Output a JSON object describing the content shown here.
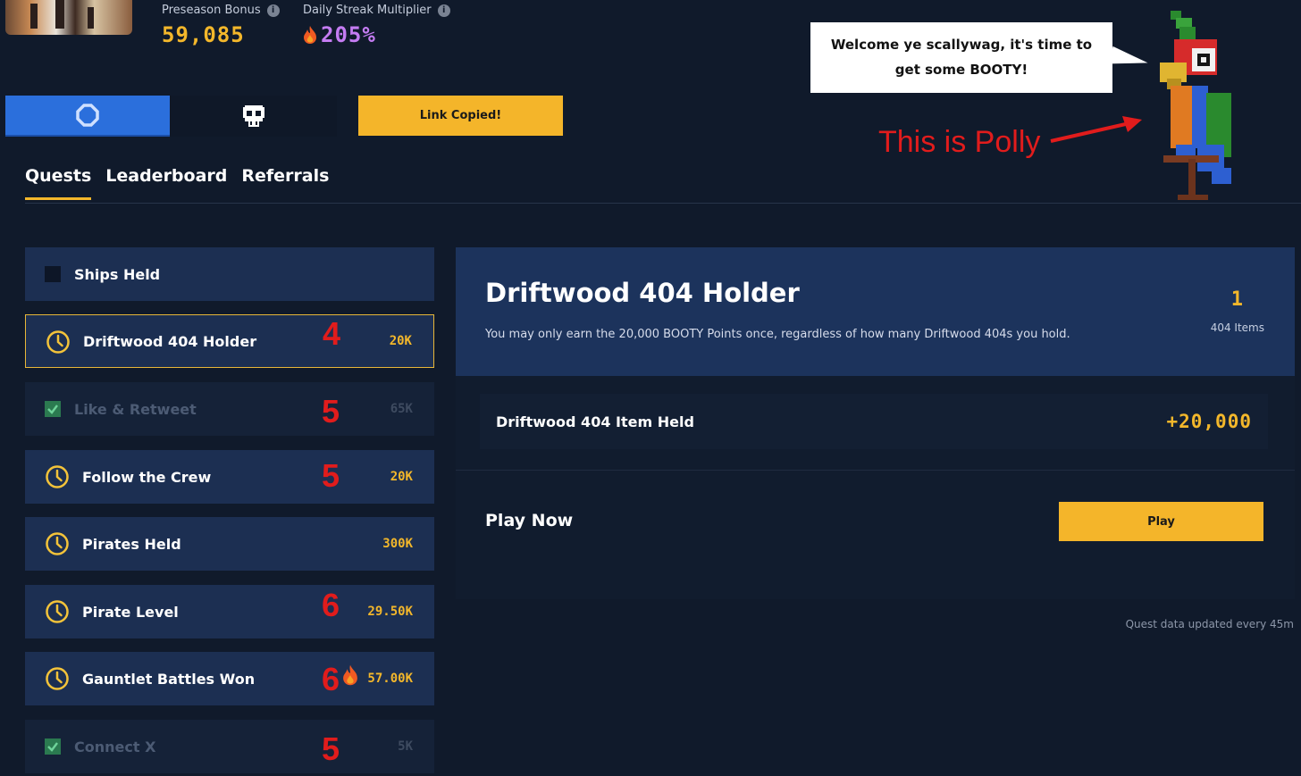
{
  "stats": {
    "preseason_label": "Preseason Bonus",
    "preseason_value": "59,085",
    "streak_label": "Daily Streak Multiplier",
    "streak_value": "205%",
    "info_icon": "i"
  },
  "actions": {
    "wallet_a_icon": "ring-icon",
    "wallet_b_icon": "skull-icon",
    "link_button_label": "Link Copied!"
  },
  "tabs": [
    {
      "label": "Quests",
      "active": true
    },
    {
      "label": "Leaderboard",
      "active": false
    },
    {
      "label": "Referrals",
      "active": false
    }
  ],
  "polly": {
    "bubble_line1": "Welcome ye scallywag, it's time to",
    "bubble_line2": "get some BOOTY!",
    "label": "This is Polly"
  },
  "quests": {
    "section_label": "Ships Held",
    "items": [
      {
        "title": "Driftwood 404 Holder",
        "points": "20K",
        "annotation": "4",
        "status": "pending",
        "selected": true
      },
      {
        "title": "Like & Retweet",
        "points": "65K",
        "annotation": "5",
        "status": "done"
      },
      {
        "title": "Follow the Crew",
        "points": "20K",
        "annotation": "5",
        "status": "pending"
      },
      {
        "title": "Pirates Held",
        "points": "300K",
        "annotation": "",
        "status": "pending"
      },
      {
        "title": "Pirate Level",
        "points": "29.50K",
        "annotation": "6",
        "status": "pending"
      },
      {
        "title": "Gauntlet Battles Won",
        "points": "57.00K",
        "annotation": "6",
        "status": "pending",
        "flame": true
      },
      {
        "title": "Connect X",
        "points": "5K",
        "annotation": "5",
        "status": "done"
      }
    ]
  },
  "detail": {
    "title": "Driftwood 404 Holder",
    "description": "You may only earn the 20,000 BOOTY Points once, regardless of how many Driftwood 404s you hold.",
    "count": "1",
    "count_label": "404 Items",
    "reward_label": "Driftwood 404 Item Held",
    "reward_value": "+20,000",
    "play_title": "Play Now",
    "play_button": "Play",
    "footnote": "Quest data updated every 45m"
  },
  "colors": {
    "background": "#101a2b",
    "accent_gold": "#f3b72b",
    "accent_purple": "#c47cf2",
    "wallet_blue": "#2b6fdc",
    "annotation_red": "#e11c1c"
  }
}
